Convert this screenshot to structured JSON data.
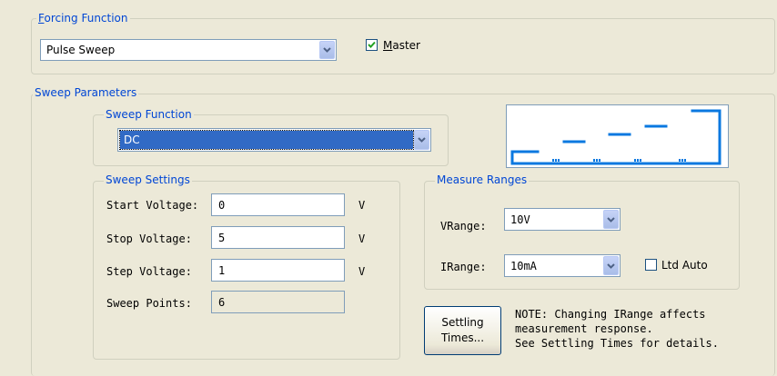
{
  "forcing_function": {
    "legend": "Forcing Function",
    "mode_value": "Pulse Sweep",
    "master_label": "Master",
    "master_checked": true
  },
  "sweep_parameters": {
    "legend": "Sweep Parameters",
    "sweep_function": {
      "legend": "Sweep Function",
      "value": "DC"
    },
    "sweep_settings": {
      "legend": "Sweep Settings",
      "start_label": "Start Voltage:",
      "start_value": "0",
      "stop_label": "Stop Voltage:",
      "stop_value": "5",
      "step_label": "Step Voltage:",
      "step_value": "1",
      "unit": "V",
      "points_label": "Sweep Points:",
      "points_value": "6"
    },
    "measure_ranges": {
      "legend": "Measure Ranges",
      "vrange_label": "VRange:",
      "vrange_value": "10V",
      "irange_label": "IRange:",
      "irange_value": "10mA",
      "ltd_auto_label": "Ltd Auto",
      "ltd_auto_checked": false
    },
    "settling_button": [
      "Settling",
      "Times..."
    ],
    "note_lines": [
      "NOTE: Changing IRange affects",
      "measurement response.",
      "See Settling Times for details."
    ]
  },
  "colors": {
    "legend_text": "#0046d5",
    "selection": "#316ac5",
    "pulse_graphic": "#0a78e0",
    "window_bg": "#ece9d8"
  },
  "icons": [
    "dropdown-arrow-icon",
    "checkmark-icon",
    "pulse-sweep-graphic"
  ]
}
